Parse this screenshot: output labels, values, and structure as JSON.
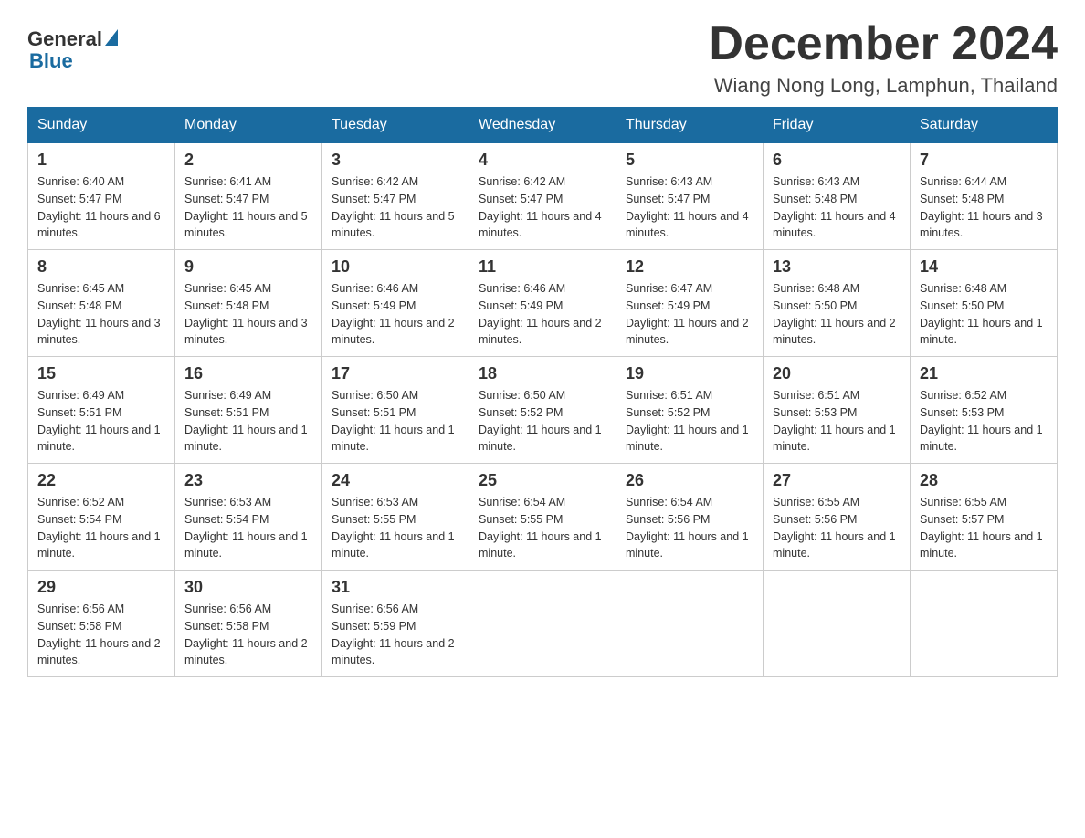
{
  "header": {
    "logo_general": "General",
    "logo_blue": "Blue",
    "month_title": "December 2024",
    "location": "Wiang Nong Long, Lamphun, Thailand"
  },
  "weekdays": [
    "Sunday",
    "Monday",
    "Tuesday",
    "Wednesday",
    "Thursday",
    "Friday",
    "Saturday"
  ],
  "weeks": [
    [
      {
        "day": "1",
        "sunrise": "6:40 AM",
        "sunset": "5:47 PM",
        "daylight": "11 hours and 6 minutes."
      },
      {
        "day": "2",
        "sunrise": "6:41 AM",
        "sunset": "5:47 PM",
        "daylight": "11 hours and 5 minutes."
      },
      {
        "day": "3",
        "sunrise": "6:42 AM",
        "sunset": "5:47 PM",
        "daylight": "11 hours and 5 minutes."
      },
      {
        "day": "4",
        "sunrise": "6:42 AM",
        "sunset": "5:47 PM",
        "daylight": "11 hours and 4 minutes."
      },
      {
        "day": "5",
        "sunrise": "6:43 AM",
        "sunset": "5:47 PM",
        "daylight": "11 hours and 4 minutes."
      },
      {
        "day": "6",
        "sunrise": "6:43 AM",
        "sunset": "5:48 PM",
        "daylight": "11 hours and 4 minutes."
      },
      {
        "day": "7",
        "sunrise": "6:44 AM",
        "sunset": "5:48 PM",
        "daylight": "11 hours and 3 minutes."
      }
    ],
    [
      {
        "day": "8",
        "sunrise": "6:45 AM",
        "sunset": "5:48 PM",
        "daylight": "11 hours and 3 minutes."
      },
      {
        "day": "9",
        "sunrise": "6:45 AM",
        "sunset": "5:48 PM",
        "daylight": "11 hours and 3 minutes."
      },
      {
        "day": "10",
        "sunrise": "6:46 AM",
        "sunset": "5:49 PM",
        "daylight": "11 hours and 2 minutes."
      },
      {
        "day": "11",
        "sunrise": "6:46 AM",
        "sunset": "5:49 PM",
        "daylight": "11 hours and 2 minutes."
      },
      {
        "day": "12",
        "sunrise": "6:47 AM",
        "sunset": "5:49 PM",
        "daylight": "11 hours and 2 minutes."
      },
      {
        "day": "13",
        "sunrise": "6:48 AM",
        "sunset": "5:50 PM",
        "daylight": "11 hours and 2 minutes."
      },
      {
        "day": "14",
        "sunrise": "6:48 AM",
        "sunset": "5:50 PM",
        "daylight": "11 hours and 1 minute."
      }
    ],
    [
      {
        "day": "15",
        "sunrise": "6:49 AM",
        "sunset": "5:51 PM",
        "daylight": "11 hours and 1 minute."
      },
      {
        "day": "16",
        "sunrise": "6:49 AM",
        "sunset": "5:51 PM",
        "daylight": "11 hours and 1 minute."
      },
      {
        "day": "17",
        "sunrise": "6:50 AM",
        "sunset": "5:51 PM",
        "daylight": "11 hours and 1 minute."
      },
      {
        "day": "18",
        "sunrise": "6:50 AM",
        "sunset": "5:52 PM",
        "daylight": "11 hours and 1 minute."
      },
      {
        "day": "19",
        "sunrise": "6:51 AM",
        "sunset": "5:52 PM",
        "daylight": "11 hours and 1 minute."
      },
      {
        "day": "20",
        "sunrise": "6:51 AM",
        "sunset": "5:53 PM",
        "daylight": "11 hours and 1 minute."
      },
      {
        "day": "21",
        "sunrise": "6:52 AM",
        "sunset": "5:53 PM",
        "daylight": "11 hours and 1 minute."
      }
    ],
    [
      {
        "day": "22",
        "sunrise": "6:52 AM",
        "sunset": "5:54 PM",
        "daylight": "11 hours and 1 minute."
      },
      {
        "day": "23",
        "sunrise": "6:53 AM",
        "sunset": "5:54 PM",
        "daylight": "11 hours and 1 minute."
      },
      {
        "day": "24",
        "sunrise": "6:53 AM",
        "sunset": "5:55 PM",
        "daylight": "11 hours and 1 minute."
      },
      {
        "day": "25",
        "sunrise": "6:54 AM",
        "sunset": "5:55 PM",
        "daylight": "11 hours and 1 minute."
      },
      {
        "day": "26",
        "sunrise": "6:54 AM",
        "sunset": "5:56 PM",
        "daylight": "11 hours and 1 minute."
      },
      {
        "day": "27",
        "sunrise": "6:55 AM",
        "sunset": "5:56 PM",
        "daylight": "11 hours and 1 minute."
      },
      {
        "day": "28",
        "sunrise": "6:55 AM",
        "sunset": "5:57 PM",
        "daylight": "11 hours and 1 minute."
      }
    ],
    [
      {
        "day": "29",
        "sunrise": "6:56 AM",
        "sunset": "5:58 PM",
        "daylight": "11 hours and 2 minutes."
      },
      {
        "day": "30",
        "sunrise": "6:56 AM",
        "sunset": "5:58 PM",
        "daylight": "11 hours and 2 minutes."
      },
      {
        "day": "31",
        "sunrise": "6:56 AM",
        "sunset": "5:59 PM",
        "daylight": "11 hours and 2 minutes."
      },
      null,
      null,
      null,
      null
    ]
  ]
}
